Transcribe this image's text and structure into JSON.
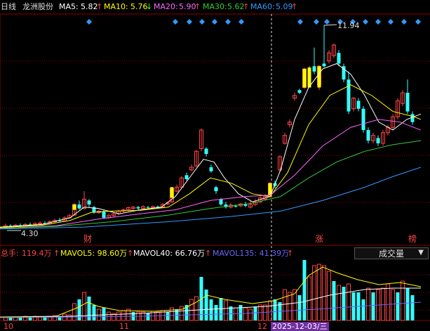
{
  "header": {
    "period_label": "日线",
    "stock_name": "龙洲股份",
    "ma": [
      {
        "label": "MA5:",
        "value": "5.82",
        "arrow": "↑",
        "color": "#ffffff"
      },
      {
        "label": "MA10:",
        "value": "5.76",
        "arrow": "↓",
        "color": "#ffff00"
      },
      {
        "label": "MA20:",
        "value": "5.90",
        "arrow": "↑",
        "color": "#ff66ff"
      },
      {
        "label": "MA30:",
        "value": "5.62",
        "arrow": "↑",
        "color": "#33cc33"
      },
      {
        "label": "MA60:",
        "value": "5.09",
        "arrow": "↑",
        "color": "#3399ff"
      }
    ]
  },
  "price_chart": {
    "high_label": "11.94",
    "low_label": "4.30",
    "markers": [
      {
        "text": "财",
        "color": "#ff4444"
      },
      {
        "text": "涨",
        "color": "#ff4444"
      },
      {
        "text": "榜",
        "color": "#ff4444"
      }
    ]
  },
  "volume_header": {
    "total_label": "总手:",
    "total_value": "119.4万",
    "total_arrow": "↑",
    "total_color": "#ff4444",
    "mavol5": "MAVOL5: 98.60万",
    "mavol5_arrow": "↑",
    "mavol40": "MAVOL40: 66.76万",
    "mavol40_arrow": "↑",
    "mavol135": "MAVOL135: 41.39万",
    "mavol135_arrow": "↑"
  },
  "volume_selector": {
    "value": "成交量",
    "caret": "▼"
  },
  "x_axis": {
    "labels": [
      "10",
      "11",
      "12"
    ],
    "cursor_date": "2025-12-03/三"
  },
  "colors": {
    "up": "#ff4444",
    "down": "#33ffff",
    "ma5": "#ffffff",
    "ma10": "#ffff00",
    "ma20": "#ff66ff",
    "ma30": "#33cc33",
    "ma60": "#3399ff",
    "grid": "#8b0000"
  },
  "chart_data": {
    "type": "candlestick",
    "high": 11.94,
    "low": 4.3,
    "moving_averages": {
      "MA5": 5.82,
      "MA10": 5.76,
      "MA20": 5.9,
      "MA30": 5.62,
      "MA60": 5.09
    },
    "volume": {
      "total_wan": 119.4,
      "MAVOL5_wan": 98.6,
      "MAVOL40_wan": 66.76,
      "MAVOL135_wan": 41.39
    }
  }
}
